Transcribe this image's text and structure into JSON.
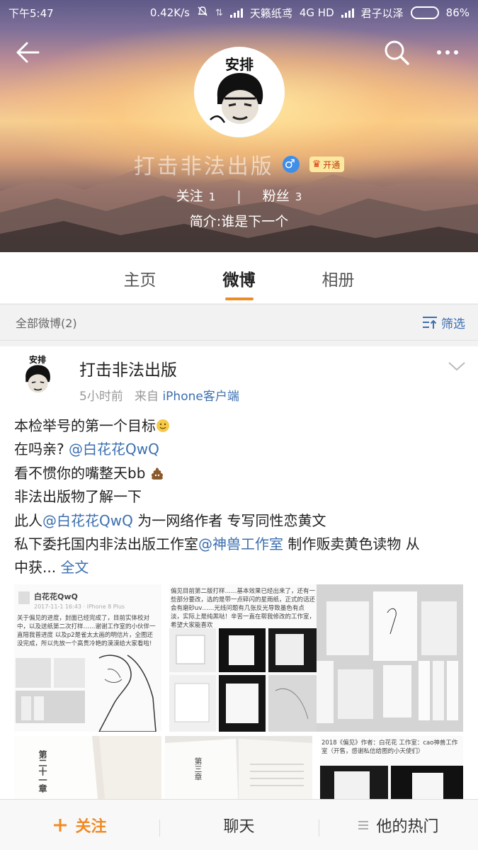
{
  "status_bar": {
    "time": "下午5:47",
    "net_speed": "0.42K/s",
    "carrier1": "天籁纸鸢",
    "network": "4G HD",
    "carrier2": "君子以泽",
    "battery": "86%",
    "battery_level": 0.86
  },
  "profile": {
    "avatar_caption": "安排",
    "name": "打击非法出版",
    "gender_icon": "♂",
    "vip_label": "开通",
    "following_label": "关注",
    "following_count": "1",
    "followers_label": "粉丝",
    "followers_count": "3",
    "bio": "简介:谁是下一个"
  },
  "tabs": [
    {
      "label": "主页",
      "active": false
    },
    {
      "label": "微博",
      "active": true
    },
    {
      "label": "相册",
      "active": false
    }
  ],
  "feed_header": {
    "all_posts": "全部微博(2)",
    "filter": "筛选"
  },
  "post": {
    "avatar_caption": "安排",
    "author": "打击非法出版",
    "time": "5小时前",
    "from": "来自",
    "source": "iPhone客户端",
    "lines": {
      "l1": "本检举号的第一个目标",
      "l2a": "在吗亲? ",
      "l2b": "@白花花QwQ",
      "l3": "看不惯你的嘴整天bb ",
      "l4": "非法出版物了解一下",
      "l5a": "此人",
      "l5b": "@白花花QwQ",
      "l5c": " 为一网络作者 专写同性恋黄文",
      "l6a": "私下委托国内非法出版工作室",
      "l6b": "@神兽工作室",
      "l6c": " 制作贩卖黄色读物 从",
      "l7a": "中获... ",
      "l7b": "全文"
    },
    "images": {
      "img1_user": "白花花QwQ",
      "img1_date": "2017-11-1 16:43 · iPhone 8 Plus",
      "img1_text": "关于偏见的进度，封面已经完成了，目前实体校对中，以及送纸第二次打样……谢谢工作室的小伙伴一直陪我普进度 以及p2是雀太太画的明信片，全图还没完成，所以先放一个高贵冷艳的漠漠给大家看啦!",
      "img2_text": "偏见目前第二版打样……基本效果已经出来了，还有一些部分要改，选的是带一点碎闪的星雨纸，正式的话还会有磨砂uv……光线问题有几张反光导致墨色有点淡，实际上是纯黑哒！辛苦一直在帮我修改的工作室，希望大家能喜欢",
      "img6_text": "2018《偏见》作者：白花花 工作室：cao神兽工作室（开售，感谢私信给图的小天使们）",
      "img4_chapter": "第二十一章",
      "img5_chapter": "第三章"
    }
  },
  "bottom_bar": {
    "follow": "关注",
    "chat": "聊天",
    "hot": "他的热门"
  },
  "colors": {
    "accent_orange": "#f08a24",
    "link_blue": "#3b6fb0"
  },
  "icons": [
    "back-arrow-icon",
    "search-icon",
    "more-icon",
    "gender-male-icon",
    "vip-crown-icon",
    "filter-icon",
    "chevron-down-icon",
    "smile-emoji-icon",
    "poop-emoji-icon",
    "plus-icon",
    "list-icon"
  ]
}
